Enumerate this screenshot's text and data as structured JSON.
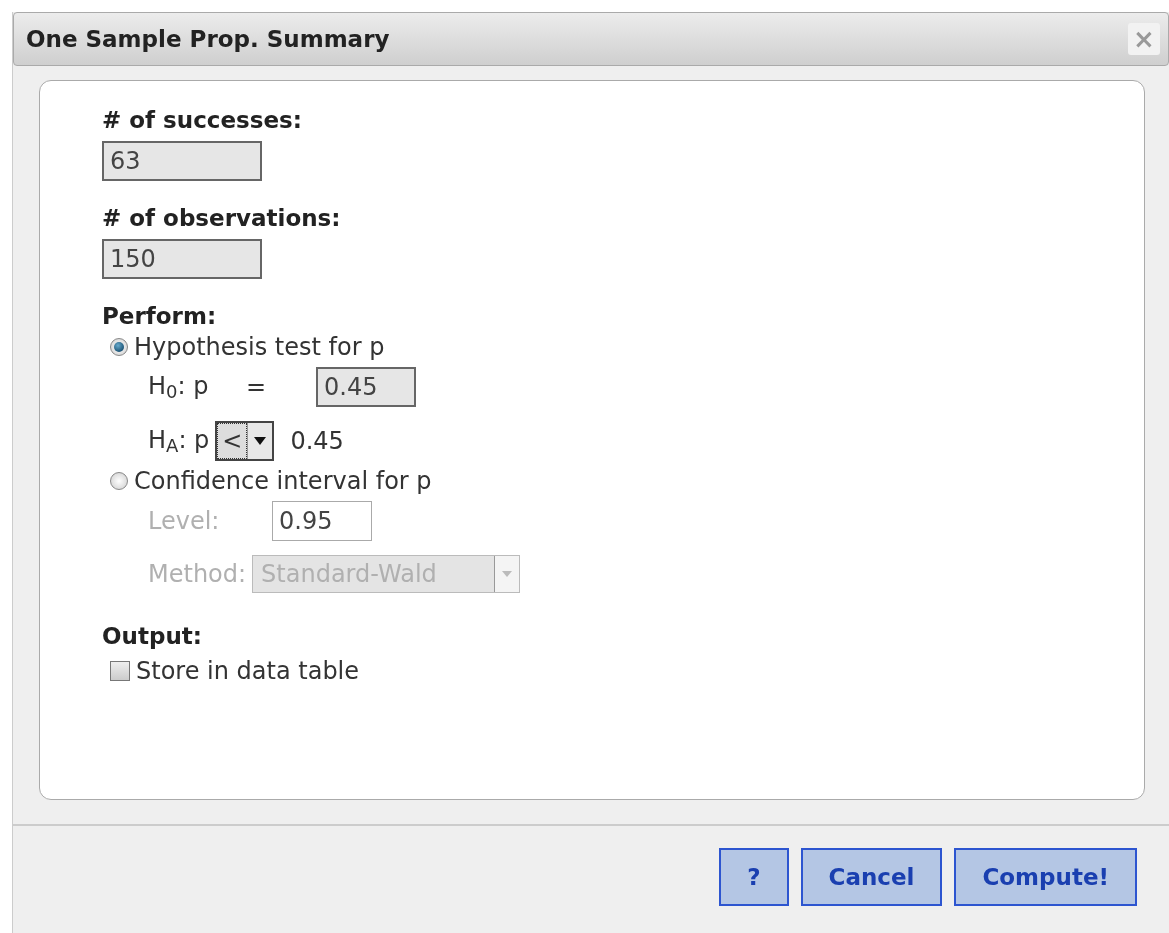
{
  "window": {
    "title": "One Sample Prop. Summary",
    "close": "×"
  },
  "successes": {
    "label": "# of successes:",
    "value": "63"
  },
  "observations": {
    "label": "# of observations:",
    "value": "150"
  },
  "perform": {
    "label": "Perform:",
    "options": [
      {
        "kind": "hypothesis",
        "label": "Hypothesis test for p",
        "selected": true
      },
      {
        "kind": "confidence",
        "label": "Confidence interval for p",
        "selected": false
      }
    ]
  },
  "hypothesis": {
    "h0_label": "H$_{0}$: p",
    "h0_sign": "=",
    "h0_value": "0.45",
    "ha_label": "H$_{A}$: p",
    "ha_operator": "<",
    "ha_value": "0.45",
    "disabled": false
  },
  "confidence": {
    "level_label": "Level:",
    "level_value": "0.95",
    "method_label": "Method:",
    "method_value": "Standard-Wald",
    "disabled": true
  },
  "output": {
    "label": "Output:",
    "store": {
      "label": "Store in data table",
      "checked": false
    }
  },
  "buttons": [
    {
      "label": "?"
    },
    {
      "label": "Cancel"
    },
    {
      "label": "Compute!"
    }
  ]
}
